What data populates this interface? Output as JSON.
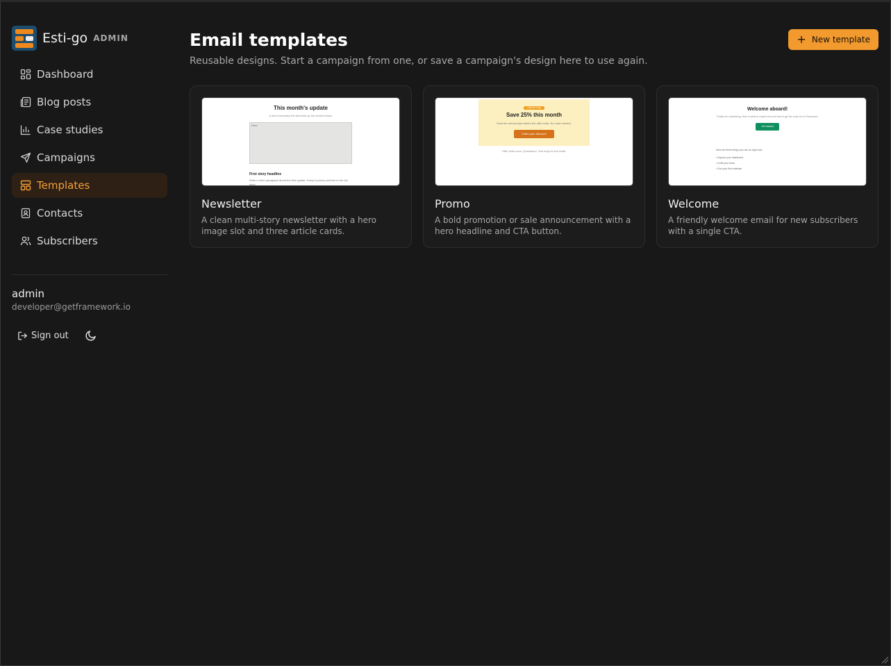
{
  "brand": {
    "name": "Esti-go",
    "tag": "ADMIN"
  },
  "nav": [
    {
      "label": "Dashboard",
      "icon": "dashboard-icon"
    },
    {
      "label": "Blog posts",
      "icon": "newspaper-icon"
    },
    {
      "label": "Case studies",
      "icon": "bar-chart-icon"
    },
    {
      "label": "Campaigns",
      "icon": "send-icon"
    },
    {
      "label": "Templates",
      "icon": "layout-icon",
      "active": true
    },
    {
      "label": "Contacts",
      "icon": "contact-book-icon"
    },
    {
      "label": "Subscribers",
      "icon": "users-icon"
    }
  ],
  "user": {
    "name": "admin",
    "email": "developer@getframework.io"
  },
  "actions": {
    "signout_label": "Sign out",
    "theme_icon": "moon-icon"
  },
  "page": {
    "title": "Email templates",
    "subtitle": "Reusable designs. Start a campaign from one, or save a campaign's design here to use again.",
    "new_button": "New template"
  },
  "templates": [
    {
      "title": "Newsletter",
      "description": "A clean multi-story newsletter with a hero image slot and three article cards.",
      "preview": {
        "heading": "This month's update",
        "sub": "A short summary line that sets up the stories below.",
        "hero_label": "Hero",
        "story_headline": "First story headline",
        "story_body": "Write a short paragraph about the first update. Keep it punchy and link to the full story."
      }
    },
    {
      "title": "Promo",
      "description": "A bold promotion or sale announcement with a hero headline and CTA button.",
      "preview": {
        "badge": "LIMITED TIME",
        "heading": "Save 25% this month",
        "sub": "Grab the annual plan before the offer ends. No code needed.",
        "cta": "Claim your discount",
        "footer": "Offer ends soon. Questions? Just reply to this email."
      }
    },
    {
      "title": "Welcome",
      "description": "A friendly welcome email for new subscribers with a single CTA.",
      "preview": {
        "heading": "Welcome aboard!",
        "sub": "Thanks for subscribing. Here is what to expect next and how to get the most out of Framework.",
        "cta": "Get started",
        "list_intro": "Here are three things you can do right now:",
        "items": [
          "Explore your dashboard",
          "Invite your team",
          "Run your first estimate"
        ]
      }
    }
  ],
  "colors": {
    "accent": "#f39a2f",
    "active_bg": "#2e2014",
    "active_text": "#f5a03a",
    "background": "#181818"
  }
}
